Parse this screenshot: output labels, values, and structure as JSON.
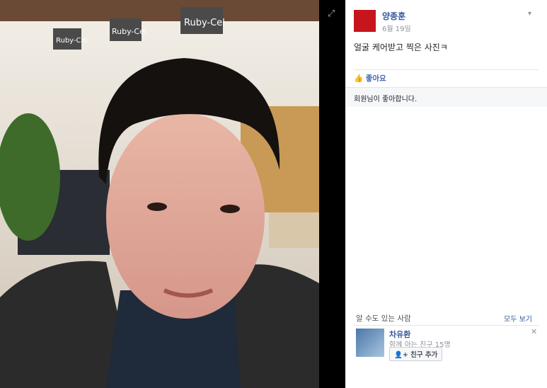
{
  "photo": {
    "signs": [
      "Ruby-Cel",
      "Ruby-Cel",
      "Ruby-Cel"
    ]
  },
  "post": {
    "author": "양종훈",
    "date": "6월 19일",
    "caption": "얼굴 케어받고 찍은 사진ㅋ",
    "like_label": "좋아요",
    "likes_text": "회원님이 좋아합니다."
  },
  "pymk": {
    "title": "알 수도 있는 사람",
    "see_all": "모두 보기",
    "person": {
      "name": "차유환",
      "mutual": "함께 아는 친구 15명",
      "add_label": "친구 추가"
    }
  },
  "colors": {
    "link": "#365899",
    "like_blue": "#4267b2",
    "avatar_red": "#c6151d"
  },
  "icons": [
    "expand-icon",
    "chevron-down-icon",
    "like-icon",
    "close-icon",
    "add-friend-icon"
  ]
}
